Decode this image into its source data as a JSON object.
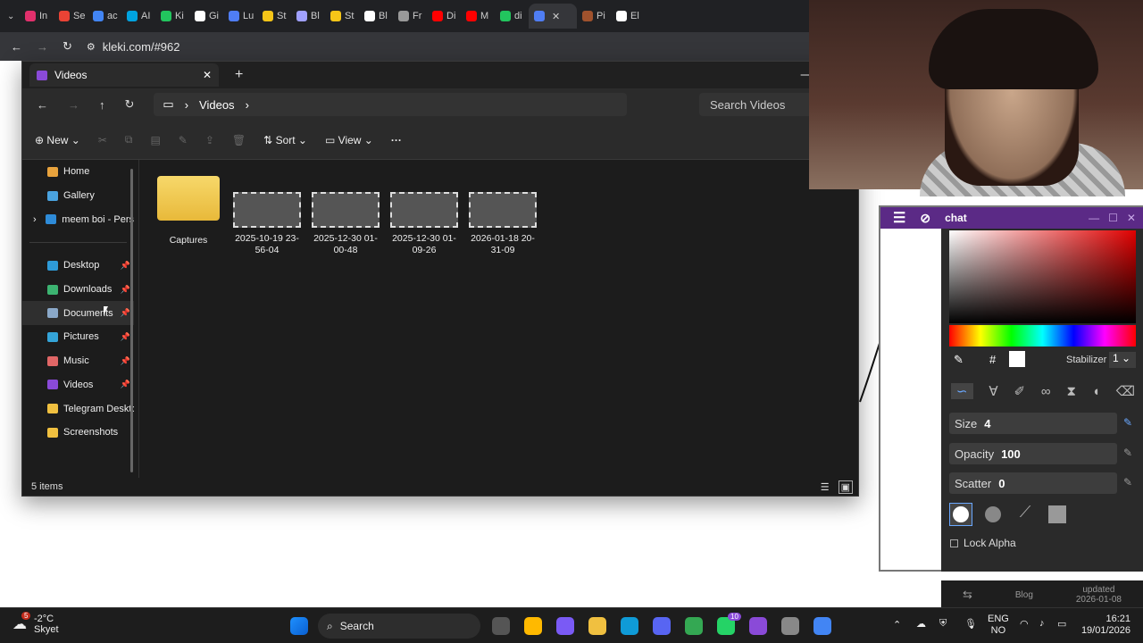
{
  "browser": {
    "tabs": [
      {
        "label": "In",
        "color": "#e1306c"
      },
      {
        "label": "Se",
        "color": "#ea4335"
      },
      {
        "label": "ac",
        "color": "#4285f4"
      },
      {
        "label": "AI",
        "color": "#00a3e0"
      },
      {
        "label": "Ki",
        "color": "#22c55e"
      },
      {
        "label": "Gi",
        "color": "#ffffff"
      },
      {
        "label": "Lu",
        "color": "#4f7df3"
      },
      {
        "label": "St",
        "color": "#f5c518"
      },
      {
        "label": "Bl",
        "color": "#a0a0ff"
      },
      {
        "label": "St",
        "color": "#f5c518"
      },
      {
        "label": "Bl",
        "color": "#ffffff"
      },
      {
        "label": "Fr",
        "color": "#999999"
      },
      {
        "label": "Di",
        "color": "#ff0000"
      },
      {
        "label": "M",
        "color": "#ff0000"
      },
      {
        "label": "di",
        "color": "#22c55e"
      },
      {
        "label": "",
        "color": "#4f7df3"
      },
      {
        "label": "Pi",
        "color": "#a0522d"
      },
      {
        "label": "El",
        "color": "#ffffff"
      }
    ],
    "active_tab_close": "✕",
    "url": "kleki.com/#962"
  },
  "explorer": {
    "tab_title": "Videos",
    "breadcrumb": "Videos",
    "search_placeholder": "Search Videos",
    "new_label": "New",
    "sort_label": "Sort",
    "view_label": "View",
    "sidebar": {
      "top": [
        {
          "label": "Home",
          "color": "#e8a33d"
        },
        {
          "label": "Gallery",
          "color": "#4aa3df"
        },
        {
          "label": "meem boi - Pers",
          "color": "#2e8bd8"
        }
      ],
      "quick": [
        {
          "label": "Desktop",
          "color": "#2e9bd8"
        },
        {
          "label": "Downloads",
          "color": "#3cb371"
        },
        {
          "label": "Documents",
          "color": "#8aa8c8"
        },
        {
          "label": "Pictures",
          "color": "#34a4d8"
        },
        {
          "label": "Music",
          "color": "#e06666"
        },
        {
          "label": "Videos",
          "color": "#8a4ad8"
        },
        {
          "label": "Telegram Deskto",
          "color": "#f0c040"
        },
        {
          "label": "Screenshots",
          "color": "#f0c040"
        }
      ]
    },
    "files": [
      {
        "name": "Captures",
        "type": "folder"
      },
      {
        "name": "2025-10-19 23-56-04",
        "type": "video"
      },
      {
        "name": "2025-12-30 01-00-48",
        "type": "video"
      },
      {
        "name": "2025-12-30 01-09-26",
        "type": "video"
      },
      {
        "name": "2026-01-18 20-31-09",
        "type": "video"
      }
    ],
    "status": "5 items"
  },
  "kleki": {
    "title": "chat",
    "hex_label": "#",
    "stabilizer_label": "Stabilizer",
    "stabilizer_value": "1",
    "size_label": "Size",
    "size_value": "4",
    "opacity_label": "Opacity",
    "opacity_value": "100",
    "scatter_label": "Scatter",
    "scatter_value": "0",
    "lock_alpha": "Lock Alpha",
    "blog": "Blog",
    "updated": "updated",
    "updated_date": "2026-01-08"
  },
  "taskbar": {
    "weather_badge": "5",
    "temp": "-2°C",
    "weather": "Skyet",
    "search": "Search",
    "lang_top": "ENG",
    "lang_bottom": "NO",
    "time": "16:21",
    "date": "19/01/2026",
    "whatsapp_badge": "10"
  },
  "colors": {
    "kleki_header": "#5b2a86",
    "accent": "#0078d4"
  }
}
